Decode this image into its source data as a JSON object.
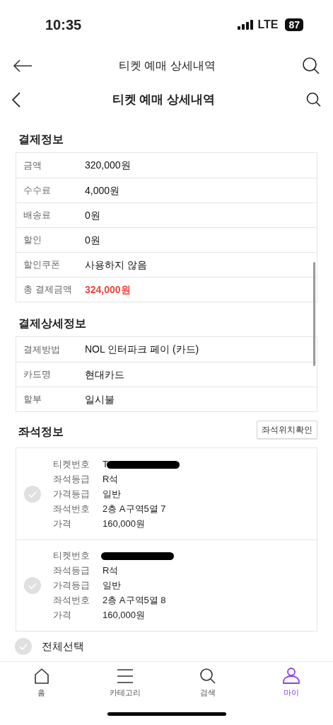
{
  "status_bar": {
    "time": "10:35",
    "network": "LTE",
    "battery": "87"
  },
  "header_outer": {
    "title": "티켓 예매 상세내역"
  },
  "header_inner": {
    "title": "티켓 예매 상세내역"
  },
  "payment": {
    "title": "결제정보",
    "rows": [
      {
        "label": "금액",
        "value": "320,000원",
        "highlight": false
      },
      {
        "label": "수수료",
        "value": "4,000원",
        "highlight": false
      },
      {
        "label": "배송료",
        "value": "0원",
        "highlight": false
      },
      {
        "label": "할인",
        "value": "0원",
        "highlight": false
      },
      {
        "label": "할인쿠폰",
        "value": "사용하지 않음",
        "highlight": false
      },
      {
        "label": "총 결제금액",
        "value": "324,000원",
        "highlight": true
      }
    ]
  },
  "payment_detail": {
    "title": "결제상세정보",
    "rows": [
      {
        "label": "결제방법",
        "value": "NOL 인터파크 페이 (카드)"
      },
      {
        "label": "카드명",
        "value": "현대카드"
      },
      {
        "label": "할부",
        "value": "일시불"
      }
    ]
  },
  "seats": {
    "title": "좌석정보",
    "location_button": "좌석위치확인",
    "tickets": [
      {
        "checked": false,
        "fields": [
          {
            "label": "티켓번호",
            "value": "T",
            "redacted": true
          },
          {
            "label": "좌석등급",
            "value": "R석",
            "redacted": false
          },
          {
            "label": "가격등급",
            "value": "일반",
            "redacted": false
          },
          {
            "label": "좌석번호",
            "value": "2층 A구역5열 7",
            "redacted": false
          },
          {
            "label": "가격",
            "value": "160,000원",
            "redacted": false
          }
        ]
      },
      {
        "checked": false,
        "fields": [
          {
            "label": "티켓번호",
            "redacted": true
          },
          {
            "label": "좌석등급",
            "value": "R석",
            "redacted": false
          },
          {
            "label": "가격등급",
            "value": "일반",
            "redacted": false
          },
          {
            "label": "좌석번호",
            "value": "2층 A구역5열 8",
            "redacted": false
          },
          {
            "label": "가격",
            "value": "160,000원",
            "redacted": false
          }
        ]
      }
    ],
    "select_all": {
      "label": "전체선택",
      "checked": false
    }
  },
  "tab_bar": [
    {
      "label": "홈",
      "selected": false
    },
    {
      "label": "카테고리",
      "selected": false
    },
    {
      "label": "검색",
      "selected": false
    },
    {
      "label": "마이",
      "selected": true
    }
  ]
}
